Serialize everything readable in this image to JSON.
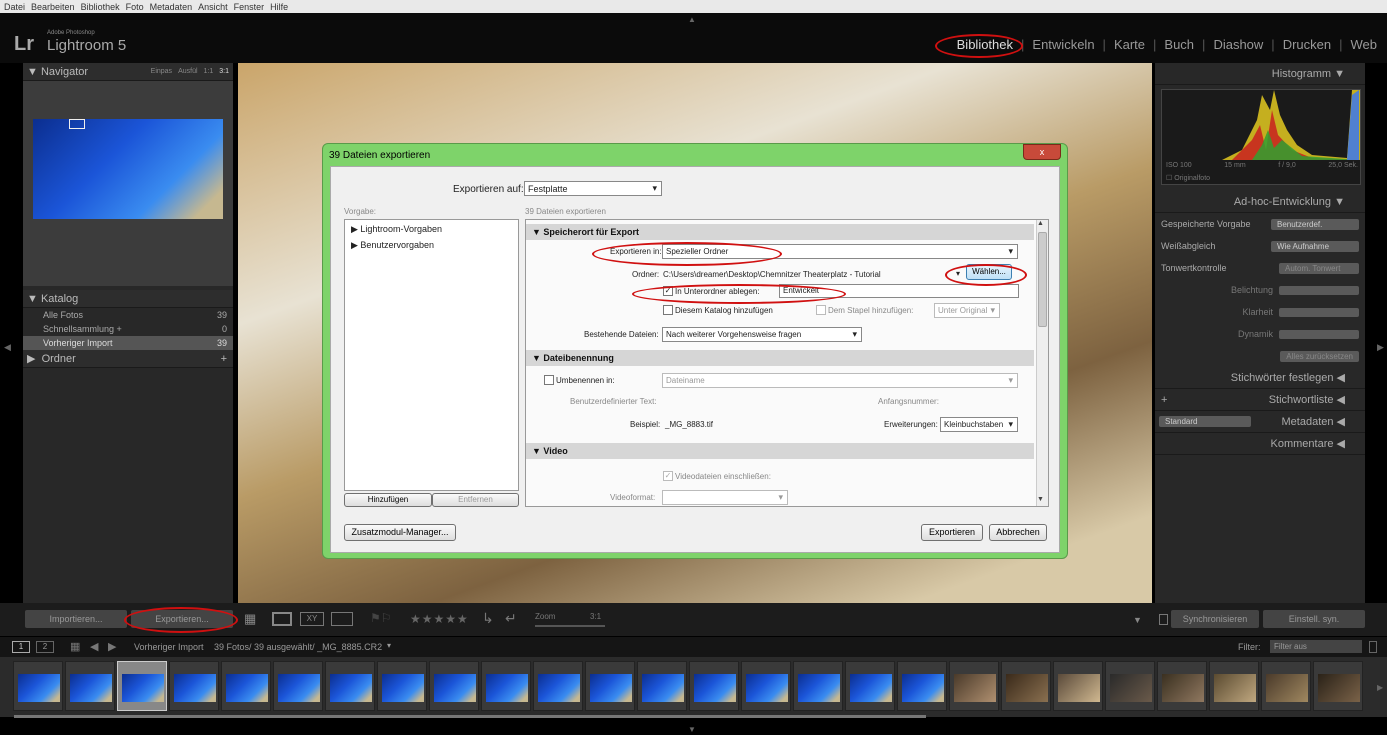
{
  "menu": [
    "Datei",
    "Bearbeiten",
    "Bibliothek",
    "Foto",
    "Metadaten",
    "Ansicht",
    "Fenster",
    "Hilfe"
  ],
  "app": {
    "logo": "Lr",
    "sub": "Adobe Photoshop",
    "name": "Lightroom 5"
  },
  "modules": [
    "Bibliothek",
    "Entwickeln",
    "Karte",
    "Buch",
    "Diashow",
    "Drucken",
    "Web"
  ],
  "left": {
    "navigator": "Navigator",
    "nav_opts": [
      "Einpas",
      "Ausfül",
      "1:1",
      "3:1"
    ],
    "katalog": "Katalog",
    "katalog_items": [
      {
        "label": "Alle Fotos",
        "count": "39"
      },
      {
        "label": "Schnellsammlung +",
        "count": "0"
      },
      {
        "label": "Vorheriger Import",
        "count": "39"
      }
    ],
    "ordner": "Ordner",
    "import_btn": "Importieren...",
    "export_btn": "Exportieren..."
  },
  "right": {
    "histogramm": "Histogramm",
    "iso": "ISO 100",
    "mm": "15 mm",
    "f": "f / 9,0",
    "sek": "25,0 Sek.",
    "originalfoto": "Originalfoto",
    "adhoc": "Ad-hoc-Entwicklung",
    "gespeicherte": "Gespeicherte Vorgabe",
    "gespeicherte_val": "Benutzerdef.",
    "weiss": "Weißabgleich",
    "weiss_val": "Wie Aufnahme",
    "tonwert": "Tonwertkontrolle",
    "tonwert_btn": "Autom. Tonwert",
    "belichtung": "Belichtung",
    "klarheit": "Klarheit",
    "dynamik": "Dynamik",
    "reset": "Alles zurücksetzen",
    "stichwort_festlegen": "Stichwörter festlegen",
    "stichwortliste": "Stichwortliste",
    "metadaten": "Metadaten",
    "standard": "Standard",
    "kommentare": "Kommentare",
    "sync_btn": "Synchronisieren",
    "einst_btn": "Einstell. syn."
  },
  "toolbar": {
    "zoom": "Zoom",
    "zoom_val": "3:1",
    "stars": "★★★★★",
    "xy": "XY"
  },
  "filmstrip": {
    "pages": [
      "1",
      "2"
    ],
    "source": "Vorheriger Import",
    "info": "39 Fotos/ 39 ausgewählt/ _MG_8885.CR2",
    "filter_label": "Filter:",
    "filter_val": "Filter aus"
  },
  "dialog": {
    "title": "39 Dateien exportieren",
    "close": "x",
    "export_to_label": "Exportieren auf:",
    "export_to_val": "Festplatte",
    "vorgabe": "Vorgabe:",
    "files_label": "39 Dateien exportieren",
    "presets": [
      "Lightroom-Vorgaben",
      "Benutzervorgaben"
    ],
    "add_btn": "Hinzufügen",
    "remove_btn": "Entfernen",
    "sec_speicherort": "Speicherort für Export",
    "exp_in_label": "Exportieren in:",
    "exp_in_val": "Spezieller Ordner",
    "ordner_label": "Ordner:",
    "ordner_val": "C:\\Users\\dreamer\\Desktop\\Chemnitzer Theaterplatz - Tutorial",
    "waehlen_btn": "Wählen...",
    "unterordner_label": "In Unterordner ablegen:",
    "unterordner_val": "Entwickelt",
    "katalog_label": "Diesem Katalog hinzufügen",
    "stapel_label": "Dem Stapel hinzufügen:",
    "stapel_val": "Unter Original",
    "bestehende_label": "Bestehende Dateien:",
    "bestehende_val": "Nach weiterer Vorgehensweise fragen",
    "sec_dateibenennung": "Dateibenennung",
    "umbenennen_label": "Umbenennen in:",
    "umbenennen_val": "Dateiname",
    "benutzer_text": "Benutzerdefinierter Text:",
    "anfangsnummer": "Anfangsnummer:",
    "beispiel_label": "Beispiel:",
    "beispiel_val": "_MG_8883.tif",
    "erweiterungen_label": "Erweiterungen:",
    "erweiterungen_val": "Kleinbuchstaben",
    "sec_video": "Video",
    "video_label": "Videodateien einschließen:",
    "videoformat_label": "Videoformat:",
    "zusatz_btn": "Zusatzmodul-Manager...",
    "export_btn": "Exportieren",
    "cancel_btn": "Abbrechen"
  }
}
